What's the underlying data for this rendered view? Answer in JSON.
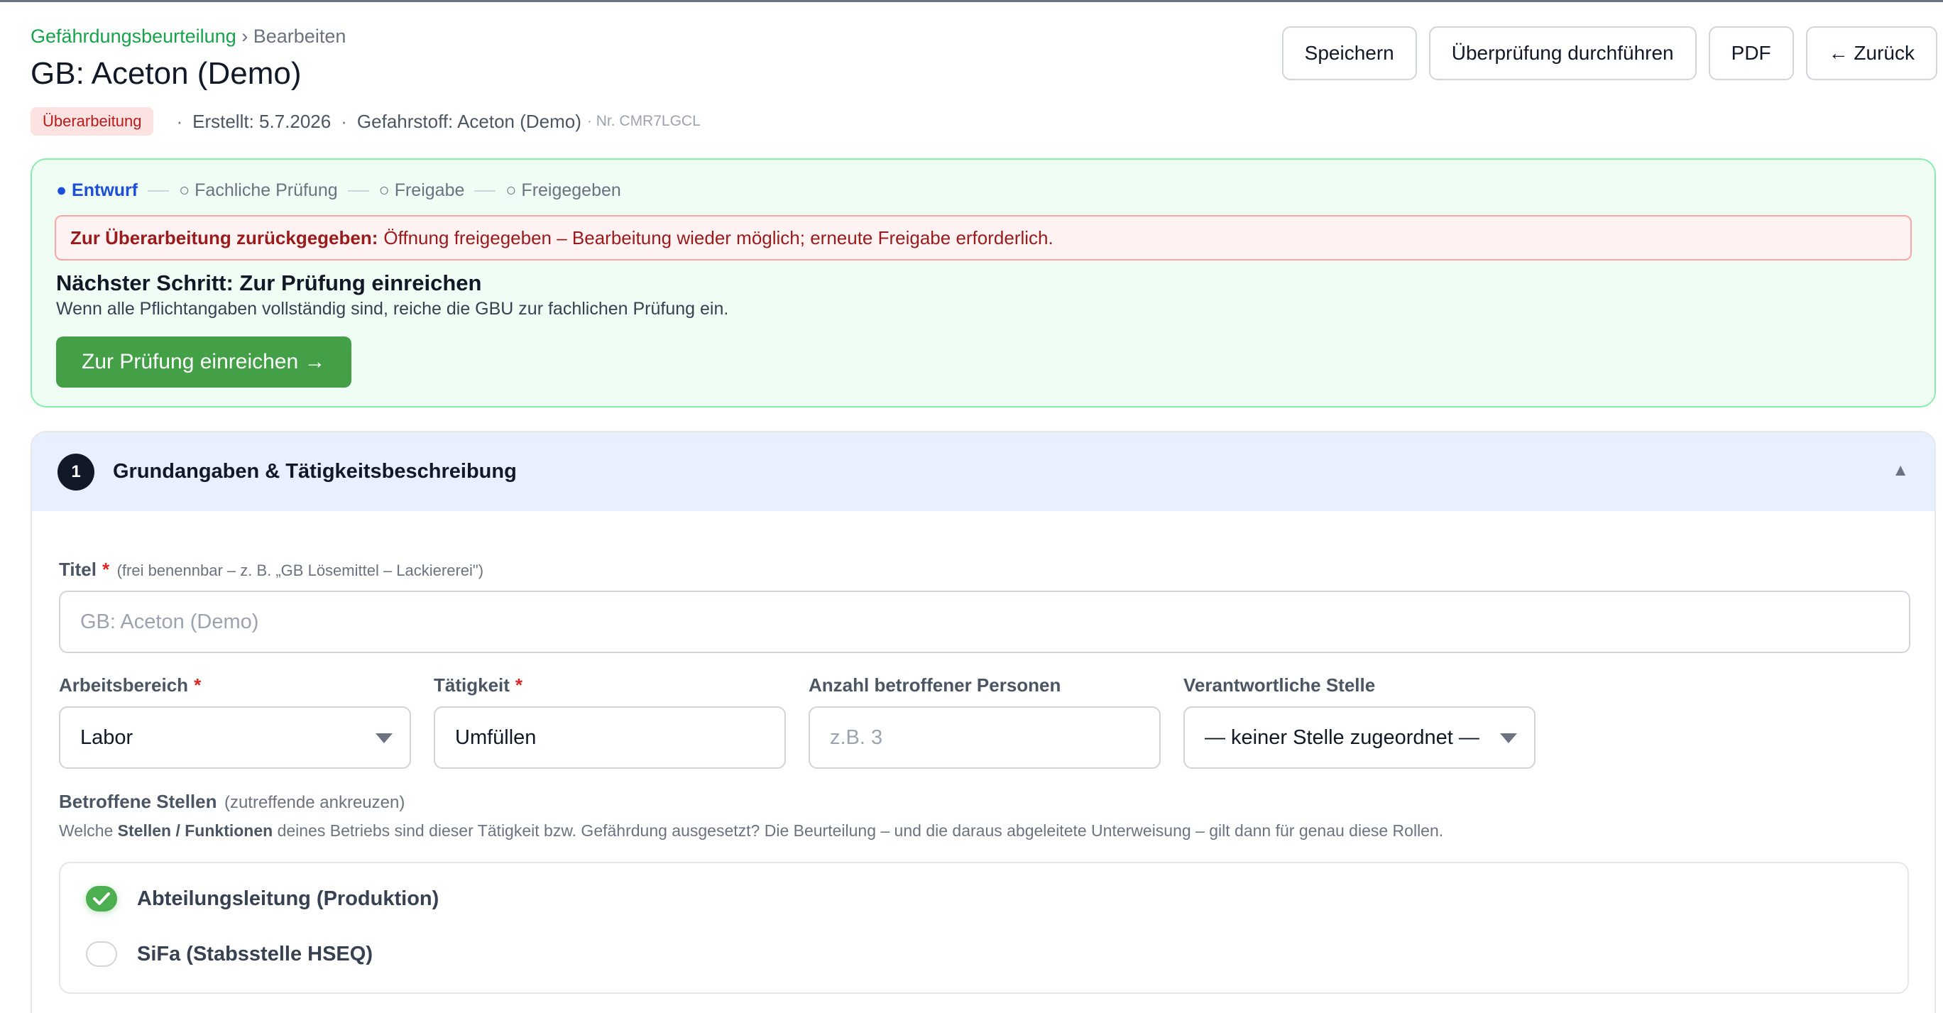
{
  "breadcrumb": {
    "parent": "Gefährdungsbeurteilung",
    "sep": "›",
    "current": "Bearbeiten"
  },
  "page_title": "GB: Aceton (Demo)",
  "meta": {
    "status_badge": "Überarbeitung",
    "created": "Erstellt: 5.7.2026",
    "substance": "Gefahrstoff: Aceton (Demo)",
    "nr": "· Nr. CMR7LGCL",
    "sep": "·"
  },
  "actions": {
    "save": "Speichern",
    "review": "Überprüfung durchführen",
    "pdf": "PDF",
    "back": "← Zurück"
  },
  "workflow": {
    "steps": [
      "● Entwurf",
      "○ Fachliche Prüfung",
      "○ Freigabe",
      "○ Freigegeben"
    ],
    "alert_strong": "Zur Überarbeitung zurückgegeben:",
    "alert_text": "Öffnung freigegeben – Bearbeitung wieder möglich; erneute Freigabe erforderlich.",
    "next_title": "Nächster Schritt: Zur Prüfung einreichen",
    "next_desc": "Wenn alle Pflichtangaben vollständig sind, reiche die GBU zur fachlichen Prüfung ein.",
    "submit": "Zur Prüfung einreichen →"
  },
  "section": {
    "number": "1",
    "title": "Grundangaben & Tätigkeitsbeschreibung",
    "collapse": "▲"
  },
  "form": {
    "title_label": "Titel",
    "required_mark": "*",
    "title_hint": "(frei benennbar – z. B. „GB Lösemittel – Lackiererei\")",
    "title_placeholder": "GB: Aceton (Demo)",
    "area_label": "Arbeitsbereich",
    "area_value": "Labor",
    "activity_label": "Tätigkeit",
    "activity_value": "Umfüllen",
    "persons_label": "Anzahl betroffener Personen",
    "persons_placeholder": "z.B. 3",
    "responsible_label": "Verantwortliche Stelle",
    "responsible_value": "— keiner Stelle zugeordnet —",
    "roles_label": "Betroffene Stellen",
    "roles_hint": "(zutreffende ankreuzen)",
    "roles_desc_pre": "Welche ",
    "roles_desc_bold": "Stellen / Funktionen",
    "roles_desc_post": " deines Betriebs sind dieser Tätigkeit bzw. Gefährdung ausgesetzt? Die Beurteilung – und die daraus abgeleitete Unterweisung – gilt dann für genau diese Rollen.",
    "roles": [
      {
        "label": "Abteilungsleitung (Produktion)",
        "checked": true
      },
      {
        "label": "SiFa (Stabsstelle HSEQ)",
        "checked": false
      }
    ]
  }
}
